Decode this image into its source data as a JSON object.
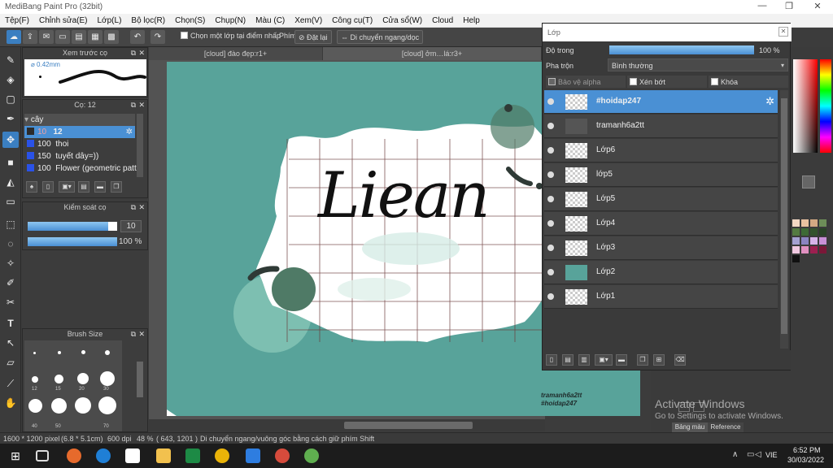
{
  "window": {
    "title": "MediBang Paint Pro (32bit)",
    "min": "—",
    "max": "❐",
    "close": "✕"
  },
  "menu": [
    "Tệp(F)",
    "Chỉnh sửa(E)",
    "Lớp(L)",
    "Bộ lọc(R)",
    "Chọn(S)",
    "Chụp(N)",
    "Màu (C)",
    "Xem(V)",
    "Công cụ(T)",
    "Cửa sổ(W)",
    "Cloud",
    "Help"
  ],
  "toolbar": {
    "select_layer_label": "Chọn một lớp tại điểm nhấp",
    "key_label": "Phím",
    "reset_label": "Đặt lại",
    "move_label": "Di chuyển ngang/dọc"
  },
  "preview_panel": {
    "title": "Xem trước cọ",
    "size": "0.42mm"
  },
  "brush_panel": {
    "title": "Cọ: 12",
    "group": "cây",
    "items": [
      {
        "size": "10",
        "name": "12"
      },
      {
        "size": "100",
        "name": "thoi"
      },
      {
        "size": "150",
        "name": "tuyết dây=))"
      },
      {
        "size": "100",
        "name": "Flower (geometric patt"
      }
    ]
  },
  "brush_control": {
    "title": "Kiểm soát cọ",
    "size_value": "10",
    "opacity_value": "100 %",
    "size_fraction": 0.9,
    "opacity_fraction": 1.0
  },
  "brush_size": {
    "title": "Brush Size",
    "labels": [
      "12",
      "15",
      "20",
      "30",
      "40",
      "50",
      "70"
    ]
  },
  "tabs": [
    "[cloud] đào đẹp:r1+",
    "[cloud] ởm…lá:r3+"
  ],
  "canvas": {
    "signature": "Liean",
    "watermark_line1": "tramanh6a2tt",
    "watermark_line2": "#hoidap247"
  },
  "layer_panel": {
    "title": "Lớp",
    "opacity_label": "Độ trong",
    "opacity_value": "100 %",
    "opacity_fraction": 1.0,
    "blend_label": "Pha trộn",
    "blend_value": "Bình thường",
    "protect_alpha": "Bảo vệ alpha",
    "clipping": "Xén bớt",
    "lock": "Khóa",
    "layers": [
      {
        "name": "#hoidap247",
        "selected": true
      },
      {
        "name": "tramanh6a2tt"
      },
      {
        "name": "Lớp6"
      },
      {
        "name": "lớp5"
      },
      {
        "name": "Lớp5"
      },
      {
        "name": "Lớp4"
      },
      {
        "name": "Lớp3"
      },
      {
        "name": "Lớp2"
      },
      {
        "name": "Lớp1"
      }
    ]
  },
  "right": {
    "color_tab": "Bảng màu",
    "reference_tab": "Reference",
    "activate_title": "Activate Windows",
    "activate_sub": "Go to Settings to activate Windows."
  },
  "status": {
    "dims": "1600 * 1200 pixel",
    "physical": "(6.8 * 5.1cm)",
    "dpi": "600 dpi",
    "zoom": "48 %",
    "coords": "( 643, 1201 )",
    "hint": "Di chuyển ngang/vuông góc bằng cách giữ phím Shift"
  },
  "taskbar": {
    "lang": "VIE",
    "time": "6:52 PM",
    "date": "30/03/2022"
  },
  "colors": {
    "accent": "#3b7fc1",
    "canvas_bg": "#58a39a",
    "selected_layer": "#4a90d4"
  }
}
